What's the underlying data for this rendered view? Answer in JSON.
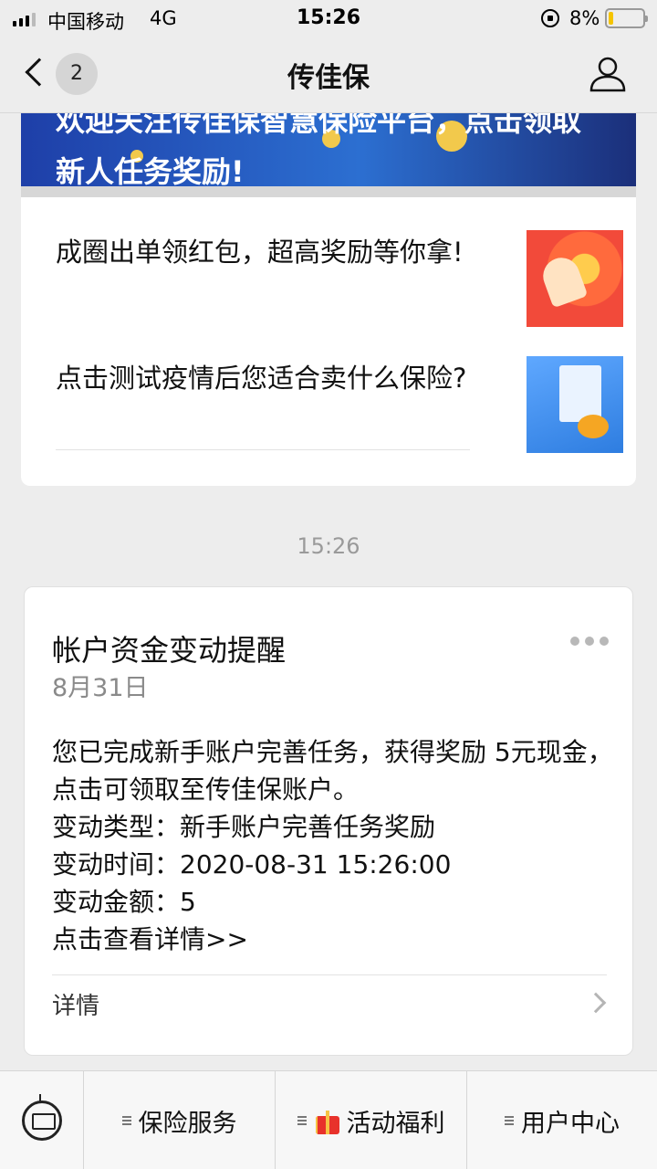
{
  "status_bar": {
    "carrier": "中国移动",
    "network": "4G",
    "time": "15:26",
    "battery": "8%"
  },
  "nav": {
    "unread_count": "2",
    "title": "传佳保"
  },
  "articles": {
    "banner_text": "欢迎关注传佳保智慧保险平台，点击领取新人任务奖励!",
    "items": [
      {
        "title": "成圈出单领红包，超高奖励等你拿!"
      },
      {
        "title": "点击测试疫情后您适合卖什么保险?"
      }
    ]
  },
  "timestamp": "15:26",
  "notice": {
    "title": "帐户资金变动提醒",
    "date": "8月31日",
    "body": "您已完成新手账户完善任务，获得奖励 5元现金，点击可领取至传佳保账户。",
    "change_type": "变动类型：新手账户完善任务奖励",
    "change_time": "变动时间：2020-08-31 15:26:00",
    "change_amount": "变动金额：5",
    "link": "点击查看详情>>",
    "detail_label": "详情"
  },
  "bottom_menu": {
    "items": [
      {
        "label": "保险服务"
      },
      {
        "label": "活动福利"
      },
      {
        "label": "用户中心"
      }
    ]
  }
}
